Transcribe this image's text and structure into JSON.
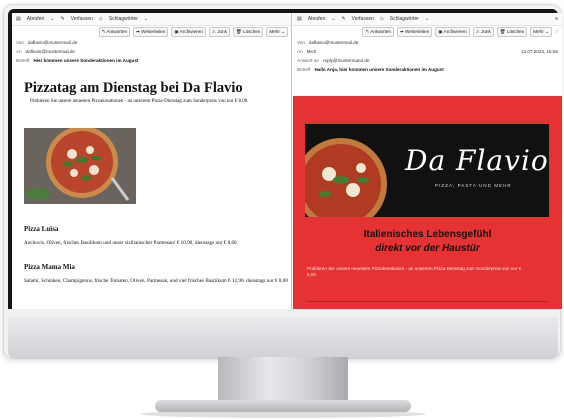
{
  "left_window": {
    "toolbar": {
      "retrieve": "Abrufen",
      "compose": "Verfassen",
      "tags": "Schlagwörter"
    },
    "actions": [
      "Antworten",
      "Weiterleiten",
      "Archivieren",
      "Junk",
      "Löschen",
      "Mehr"
    ],
    "from_label": "Von",
    "from_value": "daflavio@mustermail.de",
    "to_label": "An",
    "to_value": "daflavio@mustermail.de",
    "subject_label": "Betreff",
    "subject_value": "Hier kommen unsere Sonderaktionen im August",
    "email": {
      "heading": "Pizzatag am Dienstag bei Da Flavio",
      "intro": "Probieren Sie unsere neuesten Pizzakreationen - an unserem Pizza-Dienstag zum Sonderpreis von nur € 8,00.",
      "items": [
        {
          "name": "Pizza Luisa",
          "description": "Anchovis, Oliven, frisches Basilikum und unser sizilianischer Parmesan! € 10,90, dienstags nur € 8,00"
        },
        {
          "name": "Pizza Mama Mia",
          "description": "Salami, Schinken, Champignons, frische Tomaten, Oliven, Parmesan, und viel frisches Basilikum € 12,90, dienstags nur € 8,00"
        }
      ]
    }
  },
  "right_window": {
    "toolbar": {
      "retrieve": "Abrufen",
      "compose": "Verfassen",
      "tags": "Schlagwörter"
    },
    "actions": [
      "Antworten",
      "Weiterleiten",
      "Archivieren",
      "Junk",
      "Löschen",
      "Mehr"
    ],
    "from_label": "Von",
    "from_value": "daflavio@mustermail.de",
    "to_label": "An",
    "to_value": "Mich",
    "date": "13.07.2023, 16:55",
    "reply_label": "Antwort an",
    "reply_value": "reply@mustermann.de",
    "subject_label": "Betreff",
    "subject_value": "Hallo Anja, hier kommen unsere Sonderaktionen im August",
    "email": {
      "brand": "Da Flavio",
      "tagline": "PIZZA, PASTA UND MEHR",
      "title_line1": "Italienisches Lebensgefühl",
      "title_line2": "direkt vor der Haustür",
      "body": "Probieren Sie unsere neuesten Pizzakreationen - an unserem Pizza-Dienstag zum Sonderpreis von nur € 8,00."
    }
  },
  "colors": {
    "accent_red": "#e63232",
    "banner_black": "#111111"
  }
}
